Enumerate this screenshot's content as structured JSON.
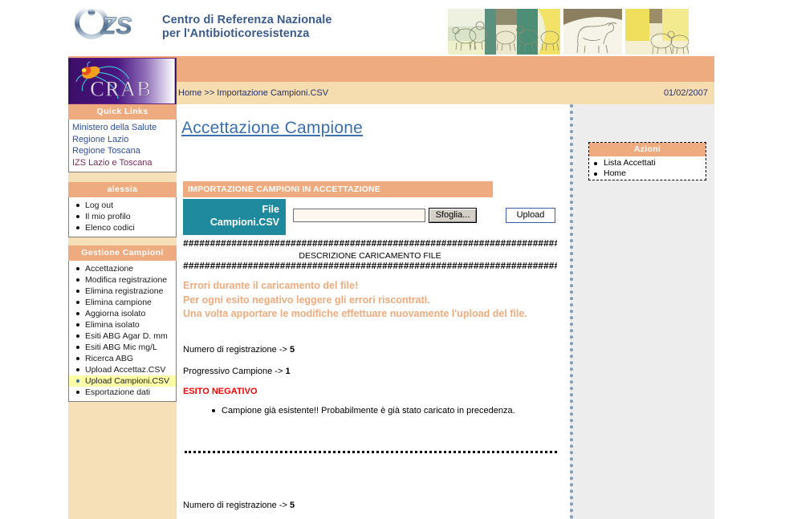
{
  "header": {
    "org_line1": "Centro di Referenza Nazionale",
    "org_line2": "per l'Antibioticoresistenza",
    "logo_text": "IZS",
    "crab_logo_text": "CRAB"
  },
  "breadcrumb": {
    "text": "Home >> Importazione Campioni.CSV",
    "date": "01/02/2007"
  },
  "sidebar": {
    "quick_links": {
      "title": "Quick Links",
      "items": [
        {
          "label": "Ministero della Salute",
          "visited": false
        },
        {
          "label": "Regione Lazio",
          "visited": false
        },
        {
          "label": "Regione Toscana",
          "visited": false
        },
        {
          "label": "IZS Lazio e Toscana",
          "visited": true
        }
      ]
    },
    "user": {
      "title": "alessia",
      "items": [
        "Log out",
        "Il mio profilo",
        "Elenco codici"
      ]
    },
    "gestione": {
      "title": "Gestione Campioni",
      "items": [
        "Accettazione",
        "Modifica registrazione",
        "Elimina registrazione",
        "Elimina campione",
        "Aggiorna isolato",
        "Elimina isolato",
        "Esiti ABG Agar D. mm",
        "Esiti ABG Mic mg/L",
        "Ricerca ABG",
        "Upload Accettaz.CSV",
        "Upload Campioni.CSV",
        "Esportazione dati"
      ],
      "current": "Upload Campioni.CSV"
    }
  },
  "main": {
    "page_title": "Accettazione Campione",
    "section_header": "IMPORTAZIONE CAMPIONI IN ACCETTAZIONE",
    "file_label_line1": "File",
    "file_label_line2": "Campioni.CSV",
    "file_input_value": "",
    "file_input_placeholder": "",
    "browse_button": "Sfoglia...",
    "upload_button": "Upload",
    "hash_rule": "########################################################################",
    "description_title": "DESCRIZIONE CARICAMENTO FILE",
    "error_banner": "Errori durante il caricamento del file!\nPer ogni esito negativo leggere gli errori riscontrati.\nUna volta apportare le modifiche effettuare nuovamente l'upload del file.",
    "record": {
      "num_reg_label": "Numero di registrazione ->",
      "num_reg_value": "5",
      "prog_label": "Progressivo Campione ->",
      "prog_value": "1",
      "esito_label": "ESITO NEGATIVO",
      "errors": [
        "Campione già esistente!! Probabilmente è già stato caricato in precedenza."
      ]
    },
    "record2": {
      "num_reg_label": "Numero di registrazione ->",
      "num_reg_value": "5"
    }
  },
  "right": {
    "azioni": {
      "title": "Azioni",
      "items": [
        "Lista Accettati",
        "Home"
      ]
    }
  },
  "colors": {
    "banner": "#eeab80",
    "sidebar_bg": "#f5e0b8",
    "breadcrumb_bg": "#f5ddb0",
    "teal": "#1f8a9e",
    "link_blue": "#2b4f9e",
    "title_blue": "#3a6fb0",
    "error_red": "#ff0000",
    "warn_orange": "#f0ab7d",
    "highlight_yellow": "#ffffa8",
    "rightcol_bg": "#ededed",
    "dotted_border": "#7e9cbd"
  }
}
